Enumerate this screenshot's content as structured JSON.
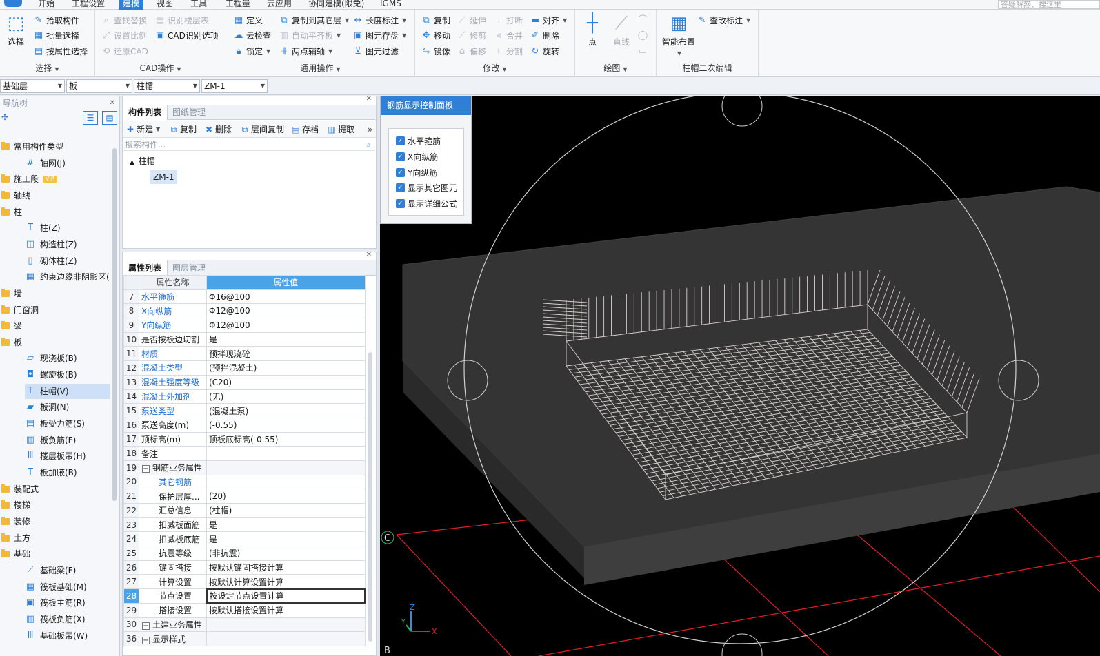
{
  "menubar": {
    "tabs": [
      "开始",
      "工程设置",
      "建模",
      "视图",
      "工具",
      "工程量",
      "云应用",
      "协同建模(限免)",
      "IGMS"
    ],
    "active_tab": "建模",
    "help_search_placeholder": "答疑解惑、搜这里"
  },
  "ribbon": {
    "select_group": {
      "title": "选择",
      "big_button": "选择",
      "buttons": [
        "拾取构件",
        "批量选择",
        "按属性选择"
      ]
    },
    "cad_group": {
      "title": "CAD操作",
      "buttons": [
        "查找替换",
        "设置比例",
        "还原CAD",
        "识别楼层表",
        "CAD识别选项"
      ]
    },
    "common_group": {
      "title": "通用操作",
      "buttons": [
        "定义",
        "云检查",
        "锁定",
        "复制到其它层",
        "自动平齐板",
        "两点辅轴",
        "长度标注",
        "图元存盘",
        "图元过滤"
      ]
    },
    "modify_group": {
      "title": "修改",
      "buttons": [
        "复制",
        "移动",
        "镜像",
        "延伸",
        "修剪",
        "偏移",
        "打断",
        "合并",
        "分割",
        "对齐",
        "删除",
        "旋转"
      ]
    },
    "draw_group": {
      "title": "绘图",
      "buttons": [
        "点",
        "直线"
      ]
    },
    "cap_group": {
      "title": "柱帽二次编辑",
      "buttons": [
        "智能布置",
        "查改标注"
      ]
    }
  },
  "selectors": {
    "floor": "基础层",
    "category": "板",
    "type": "柱帽",
    "component": "ZM-1"
  },
  "nav": {
    "title": "导航树",
    "items": [
      {
        "label": "常用构件类型",
        "kind": "folder"
      },
      {
        "label": "轴网(J)",
        "kind": "leaf",
        "icon": "#"
      },
      {
        "label": "施工段",
        "kind": "folder",
        "badge": "VIP"
      },
      {
        "label": "轴线",
        "kind": "folder"
      },
      {
        "label": "柱",
        "kind": "folder"
      },
      {
        "label": "柱(Z)",
        "kind": "leaf",
        "icon": "T"
      },
      {
        "label": "构造柱(Z)",
        "kind": "leaf",
        "icon": "◫"
      },
      {
        "label": "砌体柱(Z)",
        "kind": "leaf",
        "icon": "▯"
      },
      {
        "label": "约束边缘非阴影区(",
        "kind": "leaf",
        "icon": "▦"
      },
      {
        "label": "墙",
        "kind": "folder"
      },
      {
        "label": "门窗洞",
        "kind": "folder"
      },
      {
        "label": "梁",
        "kind": "folder"
      },
      {
        "label": "板",
        "kind": "folder"
      },
      {
        "label": "现浇板(B)",
        "kind": "leaf",
        "icon": "▱"
      },
      {
        "label": "螺旋板(B)",
        "kind": "leaf",
        "icon": "◘"
      },
      {
        "label": "柱帽(V)",
        "kind": "leaf",
        "icon": "T",
        "selected": true
      },
      {
        "label": "板洞(N)",
        "kind": "leaf",
        "icon": "▰"
      },
      {
        "label": "板受力筋(S)",
        "kind": "leaf",
        "icon": "▤"
      },
      {
        "label": "板负筋(F)",
        "kind": "leaf",
        "icon": "▥"
      },
      {
        "label": "楼层板带(H)",
        "kind": "leaf",
        "icon": "Ⅲ"
      },
      {
        "label": "板加腋(B)",
        "kind": "leaf",
        "icon": "T"
      },
      {
        "label": "装配式",
        "kind": "folder"
      },
      {
        "label": "楼梯",
        "kind": "folder"
      },
      {
        "label": "装修",
        "kind": "folder"
      },
      {
        "label": "土方",
        "kind": "folder"
      },
      {
        "label": "基础",
        "kind": "folder"
      },
      {
        "label": "基础梁(F)",
        "kind": "leaf",
        "icon": "⟋"
      },
      {
        "label": "筏板基础(M)",
        "kind": "leaf",
        "icon": "▦"
      },
      {
        "label": "筏板主筋(R)",
        "kind": "leaf",
        "icon": "▣"
      },
      {
        "label": "筏板负筋(X)",
        "kind": "leaf",
        "icon": "▥"
      },
      {
        "label": "基础板带(W)",
        "kind": "leaf",
        "icon": "Ⅲ"
      }
    ]
  },
  "component_list": {
    "tabs": [
      "构件列表",
      "图纸管理"
    ],
    "toolbar": [
      "新建",
      "复制",
      "删除",
      "层间复制",
      "存档",
      "提取"
    ],
    "search_placeholder": "搜索构件...",
    "tree_root": "柱帽",
    "tree_child": "ZM-1"
  },
  "properties": {
    "tabs": [
      "属性列表",
      "图层管理"
    ],
    "header_name": "属性名称",
    "header_value": "属性值",
    "rows": [
      {
        "n": "7",
        "name": "水平箍筋",
        "value": "Φ16@100",
        "style": "link"
      },
      {
        "n": "8",
        "name": "X向纵筋",
        "value": "Φ12@100",
        "style": "link"
      },
      {
        "n": "9",
        "name": "Y向纵筋",
        "value": "Φ12@100",
        "style": "link"
      },
      {
        "n": "10",
        "name": "是否按板边切割",
        "value": "是",
        "style": "plain"
      },
      {
        "n": "11",
        "name": "材质",
        "value": "预拌现浇砼",
        "style": "link"
      },
      {
        "n": "12",
        "name": "混凝土类型",
        "value": "(预拌混凝土)",
        "style": "link"
      },
      {
        "n": "13",
        "name": "混凝土强度等级",
        "value": "(C20)",
        "style": "link"
      },
      {
        "n": "14",
        "name": "混凝土外加剂",
        "value": "(无)",
        "style": "link"
      },
      {
        "n": "15",
        "name": "泵送类型",
        "value": "(混凝土泵)",
        "style": "link"
      },
      {
        "n": "16",
        "name": "泵送高度(m)",
        "value": "(-0.55)",
        "style": "plain"
      },
      {
        "n": "17",
        "name": "顶标高(m)",
        "value": "顶板底标高(-0.55)",
        "style": "plain"
      },
      {
        "n": "18",
        "name": "备注",
        "value": "",
        "style": "plain"
      },
      {
        "n": "19",
        "name": "钢筋业务属性",
        "value": "",
        "style": "group",
        "toggle": "−"
      },
      {
        "n": "20",
        "name": "其它钢筋",
        "value": "",
        "style": "indlink"
      },
      {
        "n": "21",
        "name": "保护层厚...",
        "value": "(20)",
        "style": "ind"
      },
      {
        "n": "22",
        "name": "汇总信息",
        "value": "(柱帽)",
        "style": "ind"
      },
      {
        "n": "23",
        "name": "扣减板面筋",
        "value": "是",
        "style": "ind"
      },
      {
        "n": "24",
        "name": "扣减板底筋",
        "value": "是",
        "style": "ind"
      },
      {
        "n": "25",
        "name": "抗震等级",
        "value": "(非抗震)",
        "style": "ind"
      },
      {
        "n": "26",
        "name": "锚固搭接",
        "value": "按默认锚固搭接计算",
        "style": "ind"
      },
      {
        "n": "27",
        "name": "计算设置",
        "value": "按默认计算设置计算",
        "style": "ind"
      },
      {
        "n": "28",
        "name": "节点设置",
        "value": "按设定节点设置计算",
        "style": "ind",
        "current": true
      },
      {
        "n": "29",
        "name": "搭接设置",
        "value": "按默认搭接设置计算",
        "style": "ind"
      },
      {
        "n": "30",
        "name": "土建业务属性",
        "value": "",
        "style": "group",
        "toggle": "+"
      },
      {
        "n": "36",
        "name": "显示样式",
        "value": "",
        "style": "group",
        "toggle": "+"
      }
    ]
  },
  "control_panel": {
    "title": "钢筋显示控制面板",
    "options": [
      "水平箍筋",
      "X向纵筋",
      "Y向纵筋",
      "显示其它图元",
      "显示详细公式"
    ]
  },
  "viewport": {
    "axis_labels": {
      "c": "C",
      "b": "B"
    },
    "gizmo": {
      "x": "X",
      "y": "Y",
      "z": "Z"
    }
  }
}
